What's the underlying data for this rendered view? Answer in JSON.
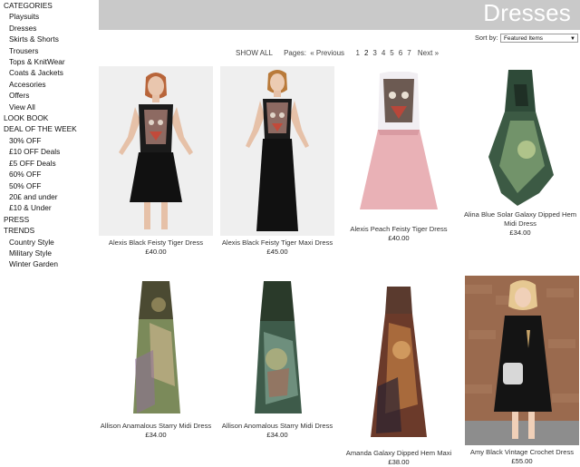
{
  "sidebar": {
    "categories_heading": "CATEGORIES",
    "categories": [
      "Playsuits",
      "Dresses",
      "Skirts & Shorts",
      "Trousers",
      "Tops & KnitWear",
      "Coats & Jackets",
      "Accesories",
      "Offers",
      "View All"
    ],
    "look_book": "LOOK BOOK",
    "deal_heading": "DEAL OF THE WEEK",
    "deals": [
      "30% OFF",
      "£10 OFF Deals",
      "£5 OFF Deals",
      "60% OFF",
      "50% OFF",
      "20£ and under",
      "£10 & Under"
    ],
    "press": "PRESS",
    "trends_heading": "TRENDS",
    "trends": [
      "Country Style",
      "Military Style",
      "Winter Garden"
    ]
  },
  "header": {
    "title": "Dresses",
    "bg_color": "#c9c9c9"
  },
  "sort": {
    "label": "Sort by:",
    "value": "Featured Items"
  },
  "pager": {
    "show_all": "SHOW ALL",
    "pages_label": "Pages:",
    "previous": "« Previous",
    "pages": [
      "1",
      "2",
      "3",
      "4",
      "5",
      "6",
      "7"
    ],
    "current": "2",
    "next": "Next »"
  },
  "products": [
    {
      "name": "Alexis Black Feisty Tiger Dress",
      "price": "£40.00"
    },
    {
      "name": "Alexis Black Feisty Tiger Maxi Dress",
      "price": "£45.00"
    },
    {
      "name": "Alexis Peach Feisty Tiger Dress",
      "price": "£40.00"
    },
    {
      "name": "Alina Blue Solar Galaxy Dipped Hem Midi Dress",
      "price": "£34.00"
    },
    {
      "name": "Allison Anamalous Starry Midi Dress",
      "price": "£34.00"
    },
    {
      "name": "Allison Anomalous Starry Midi Dress",
      "price": "£34.00"
    },
    {
      "name": "Amanda Galaxy Dipped Hem Maxi",
      "price": "£38.00"
    },
    {
      "name": "Amy Black Vintage Crochet Dress",
      "price": "£55.00"
    }
  ]
}
